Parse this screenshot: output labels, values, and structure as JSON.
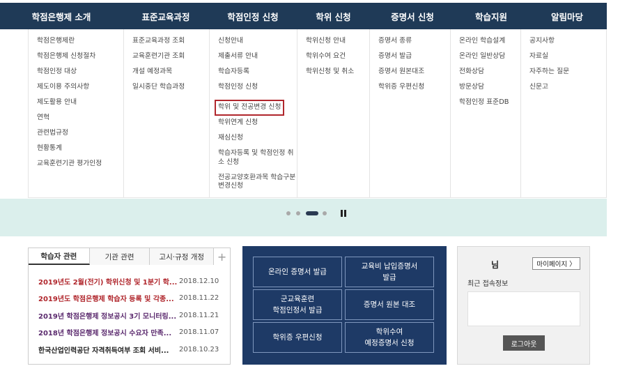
{
  "nav": {
    "items": [
      "학점은행제 소개",
      "표준교육과정",
      "학점인정 신청",
      "학위 신청",
      "증명서 신청",
      "학습지원",
      "알림마당"
    ]
  },
  "mega_menu": {
    "col1": [
      "학점은행제란",
      "학점은행제 신청절차",
      "학점인정 대상",
      "제도이용 주의사항",
      "제도활용 안내",
      "연혁",
      "관련법규정",
      "현황통계",
      "교육훈련기관 평가인정"
    ],
    "col2": [
      "표준교육과정 조회",
      "교육훈련기관 조회",
      "개설 예정과목",
      "일시중단 학습과정"
    ],
    "col3": [
      "신청안내",
      "제출서류 안내",
      "학습자등록",
      "학점인정 신청",
      "학위 및 전공변경 신청",
      "학위연계 신청",
      "재심신청",
      "학습자등록 및 학점인정 취소 신청",
      "전공교양호환과목 학습구분 변경신청"
    ],
    "col4": [
      "학위신청 안내",
      "학위수여 요건",
      "학위신청 및 취소"
    ],
    "col5": [
      "증명서 종류",
      "증명서 발급",
      "증명서 원본대조",
      "학위증 우편신청"
    ],
    "col6": [
      "온라인 학습설계",
      "온라인 일반상담",
      "전화상담",
      "방문상담",
      "학점인정 표준DB"
    ],
    "col7": [
      "공지사항",
      "자료실",
      "자주하는 질문",
      "신문고"
    ]
  },
  "slider": {
    "pause_label": "pause",
    "active_index": 2
  },
  "notice": {
    "tabs": [
      "학습자 관련",
      "기관 관련",
      "고시·규정 개정"
    ],
    "more_label": "+",
    "rows": [
      {
        "title": "2019년도 2월(전기) 학위신청 및 1분기 학...",
        "date": "2018.12.10"
      },
      {
        "title": "2019년도 학점은행제 학습자 등록 및 각종...",
        "date": "2018.11.22"
      },
      {
        "title": "2019년 학점은행제 정보공시 3기 모니터링...",
        "date": "2018.11.21"
      },
      {
        "title": "2018년 학점은행제 정보공시 수요자 만족...",
        "date": "2018.11.07"
      },
      {
        "title": "한국산업인력공단 자격취득여부 조회 서비...",
        "date": "2018.10.23"
      }
    ],
    "colors": [
      "#b0262c",
      "#b0262c",
      "#5b2a6e",
      "#5b2a6e",
      "#222222"
    ]
  },
  "quick_links": [
    "온라인 증명서 발급",
    "교육비 납입증명서\n발급",
    "군교육훈련\n학점인정서 발급",
    "증명서 원본 대조",
    "학위증 우편신청",
    "학위수여\n예정증명서 신청"
  ],
  "login": {
    "name_suffix": "님",
    "mypage_label": "마이페이지 〉",
    "recent_label": "최근 접속정보",
    "logout_label": "로그아웃"
  },
  "colors": {
    "nav_bg": "#1f3a57",
    "strip_bg": "#dbefec",
    "quick_bg": "#1e3a66",
    "highlight": "#b0262c"
  }
}
